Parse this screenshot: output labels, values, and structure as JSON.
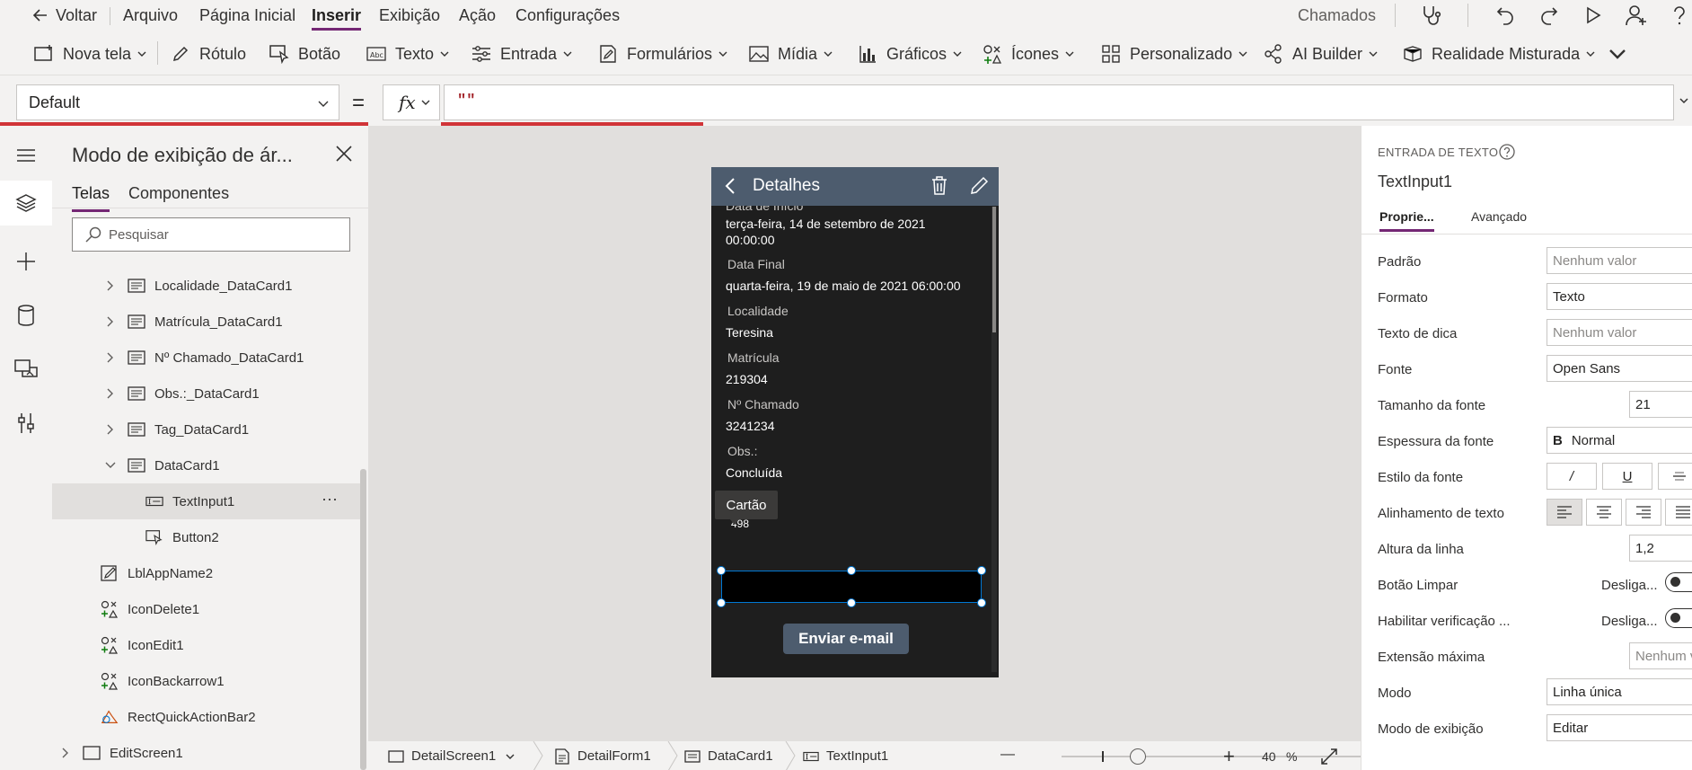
{
  "menu": {
    "back": "Voltar",
    "items": [
      "Arquivo",
      "Página Inicial",
      "Inserir",
      "Exibição",
      "Ação",
      "Configurações"
    ],
    "app_name": "Chamados"
  },
  "ribbon": {
    "new_screen": "Nova tela",
    "label": "Rótulo",
    "button": "Botão",
    "text": "Texto",
    "input": "Entrada",
    "forms": "Formulários",
    "media": "Mídia",
    "charts": "Gráficos",
    "icons": "Ícones",
    "custom": "Personalizado",
    "ai_builder": "AI Builder",
    "mixed_reality": "Realidade Misturada"
  },
  "formula": {
    "property": "Default",
    "equals": "=",
    "fx": "fx",
    "value": "\"\""
  },
  "tree": {
    "title": "Modo de exibição de ár...",
    "tabs": [
      "Telas",
      "Componentes"
    ],
    "search_placeholder": "Pesquisar",
    "nodes": [
      "Localidade_DataCard1",
      "Matrícula_DataCard1",
      "Nº Chamado_DataCard1",
      "Obs.:_DataCard1",
      "Tag_DataCard1",
      "DataCard1",
      "TextInput1",
      "Button2",
      "LblAppName2",
      "IconDelete1",
      "IconEdit1",
      "IconBackarrow1",
      "RectQuickActionBar2",
      "EditScreen1"
    ],
    "more": "···"
  },
  "phone": {
    "header_title": "Detalhes",
    "cut_label": "Data de Início",
    "fields": [
      {
        "label": "",
        "value": "terça-feira, 14 de setembro de 2021"
      },
      {
        "label": "",
        "value": "00:00:00"
      },
      {
        "label": "Data Final",
        "value": "quarta-feira, 19 de maio de 2021 06:00:00"
      },
      {
        "label": "Localidade",
        "value": "Teresina"
      },
      {
        "label": "Matrícula",
        "value": "219304"
      },
      {
        "label": "Nº Chamado",
        "value": "3241234"
      },
      {
        "label": "Obs.:",
        "value": "Concluída"
      }
    ],
    "tooltip": "Cartão",
    "partial_value": "498",
    "send_button": "Enviar e-mail"
  },
  "bottombar": {
    "crumbs": [
      "DetailScreen1",
      "DetailForm1",
      "DataCard1",
      "TextInput1"
    ],
    "zoom_minus": "—",
    "zoom_plus": "+",
    "zoom_value": "40",
    "zoom_unit": "%",
    "zoom_level": 0.4
  },
  "props": {
    "section": "ENTRADA DE TEXTO",
    "control": "TextInput1",
    "tabs": [
      "Proprie...",
      "Avançado"
    ],
    "rows": [
      {
        "label": "Padrão",
        "value": "Nenhum valor"
      },
      {
        "label": "Formato",
        "value": "Texto"
      },
      {
        "label": "Texto de dica",
        "value": "Nenhum valor"
      },
      {
        "label": "Fonte",
        "value": "Open Sans"
      },
      {
        "label": "Tamanho da fonte",
        "value": "21"
      },
      {
        "label": "Espessura da fonte",
        "value": "Normal"
      },
      {
        "label": "Estilo da fonte",
        "value": ""
      },
      {
        "label": "Alinhamento de texto",
        "value": ""
      },
      {
        "label": "Altura da linha",
        "value": "1,2"
      },
      {
        "label": "Botão Limpar",
        "value": "Desliga..."
      },
      {
        "label": "Habilitar verificação ...",
        "value": "Desliga..."
      },
      {
        "label": "Extensão máxima",
        "value": "Nenhum v"
      },
      {
        "label": "Modo",
        "value": "Linha única"
      },
      {
        "label": "Modo de exibição",
        "value": "Editar"
      }
    ],
    "bold_glyph": "B",
    "italic_glyph": "/",
    "underline_glyph": "U"
  },
  "colors": {
    "accent": "#742774",
    "highlight_red": "#d13438",
    "phone_header": "#4d5c6e",
    "phone_bg": "#1e1e1e",
    "selection": "#0078d4"
  }
}
